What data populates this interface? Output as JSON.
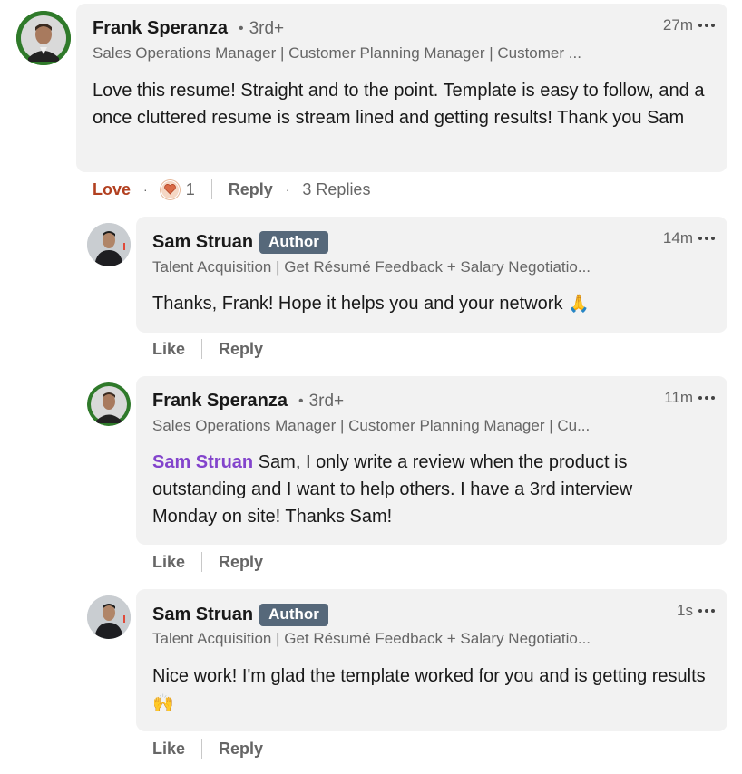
{
  "comments": [
    {
      "author": "Frank Speranza",
      "degree": "3rd+",
      "headline": "Sales Operations Manager | Customer Planning Manager | Customer ...",
      "time": "27m",
      "text": "Love this resume! Straight and to the point. Template is easy to follow, and a once cluttered resume is stream lined and getting results! Thank you Sam",
      "reaction_label": "Love",
      "reaction_icon": "heart-icon",
      "reaction_count": "1",
      "reply_label": "Reply",
      "replies_label": "3 Replies"
    }
  ],
  "replies": [
    {
      "author": "Sam Struan",
      "badge": "Author",
      "headline": "Talent Acquisition | Get Résumé Feedback + Salary Negotiatio...",
      "time": "14m",
      "text": "Thanks, Frank! Hope it helps you and your network",
      "emoji": "🙏",
      "like_label": "Like",
      "reply_label": "Reply"
    },
    {
      "author": "Frank Speranza",
      "degree": "3rd+",
      "headline": "Sales Operations Manager | Customer Planning Manager | Cu...",
      "time": "11m",
      "mention": "Sam Struan",
      "text": " Sam, I only write a review when the product is outstanding and I want to help others. I have a 3rd interview Monday on site! Thanks Sam!",
      "like_label": "Like",
      "reply_label": "Reply"
    },
    {
      "author": "Sam Struan",
      "badge": "Author",
      "headline": "Talent Acquisition | Get Résumé Feedback + Salary Negotiatio...",
      "time": "1s",
      "text": "Nice work! I'm glad the template worked for you and is getting results",
      "emoji": "🙌",
      "like_label": "Like",
      "reply_label": "Reply"
    }
  ],
  "icons": {
    "more": "more-options-icon",
    "heart": "heart-icon"
  },
  "colors": {
    "bubble": "#f2f2f2",
    "author_badge": "#56687a",
    "mention": "#8344cc",
    "love": "#b24020"
  }
}
